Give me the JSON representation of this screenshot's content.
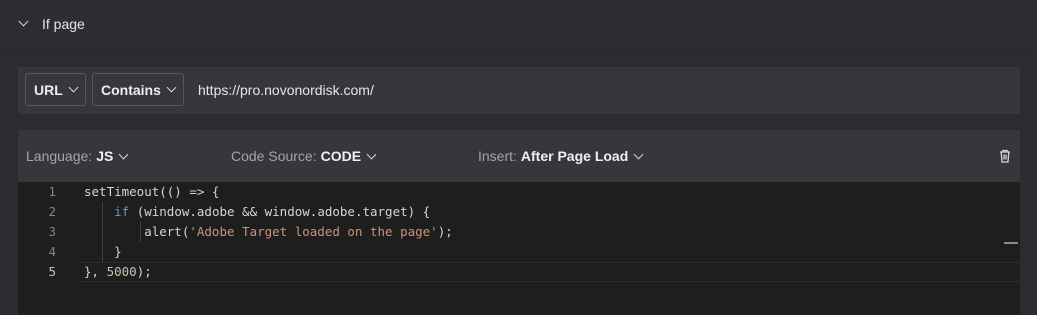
{
  "section": {
    "title": "If page",
    "toggle_icon": "chevron-down-icon"
  },
  "url_rule": {
    "match_field": "URL",
    "operator": "Contains",
    "value": "https://pro.novonordisk.com/"
  },
  "code_block": {
    "language_label": "Language:",
    "language_value": "JS",
    "source_label": "Code Source:",
    "source_value": "CODE",
    "insert_label": "Insert:",
    "insert_value": "After Page Load",
    "delete_icon": "trash-icon",
    "lines": [
      {
        "num": "1",
        "text": "setTimeout(() => {"
      },
      {
        "num": "2",
        "text": "    if (window.adobe && window.adobe.target) {"
      },
      {
        "num": "3",
        "text": "        alert('Adobe Target loaded on the page');"
      },
      {
        "num": "4",
        "text": "    }"
      },
      {
        "num": "5",
        "text": "}, 5000);"
      }
    ],
    "active_line": 5
  },
  "colors": {
    "background": "#2b2c2f",
    "panel": "#36373b",
    "editor": "#1e1e1e",
    "keyword": "#569cd6",
    "string": "#ce9178",
    "number": "#b5cea8"
  }
}
